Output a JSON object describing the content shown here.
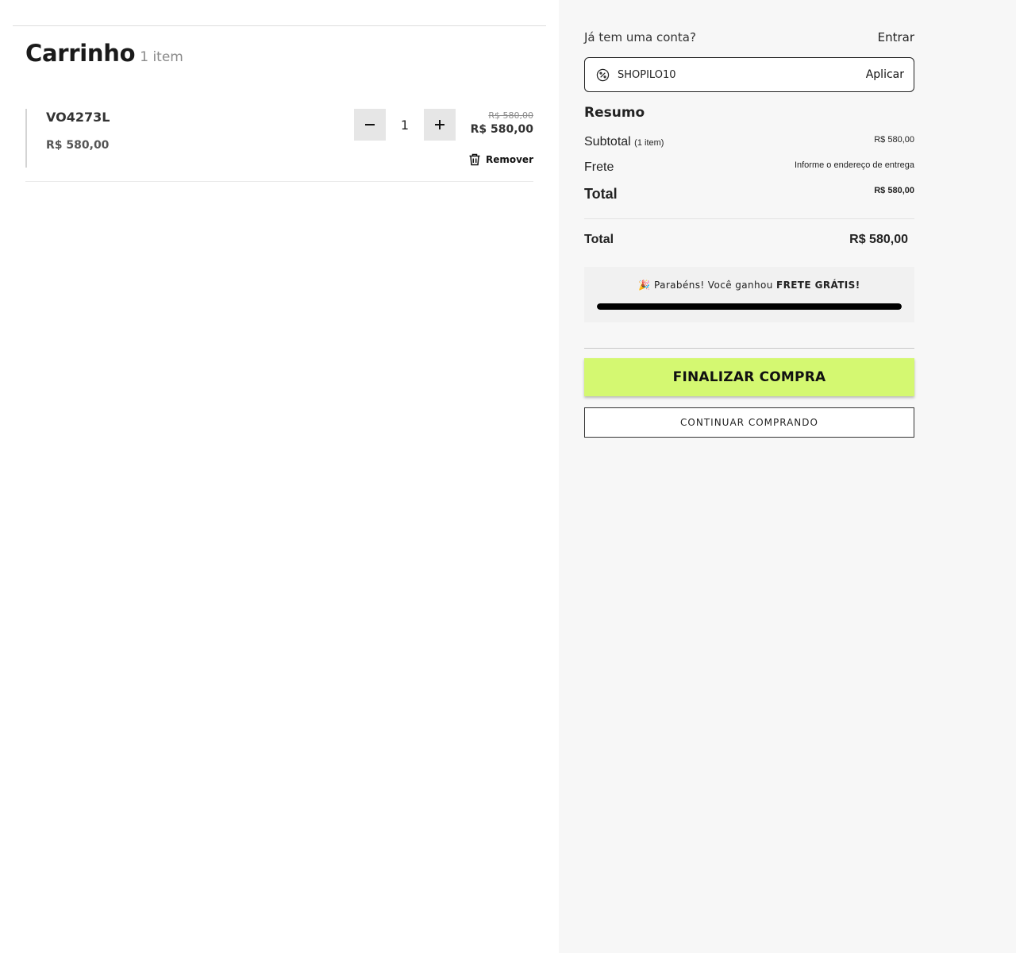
{
  "cart": {
    "title": "Carrinho",
    "count_label": "1 item",
    "items": [
      {
        "name": "VO4273L",
        "unit_price": "R$ 580,00",
        "quantity": "1",
        "old_price": "R$ 580,00",
        "price": "R$ 580,00",
        "remove_label": "Remover"
      }
    ]
  },
  "account": {
    "question": "Já tem uma conta?",
    "login_label": "Entrar"
  },
  "coupon": {
    "value": "SHOPILO10",
    "apply_label": "Aplicar"
  },
  "summary": {
    "title": "Resumo",
    "subtotal_label": "Subtotal",
    "subtotal_count": "(1 item)",
    "subtotal_value": "R$ 580,00",
    "shipping_label": "Frete",
    "shipping_value": "Informe o endereço de entrega",
    "total_label": "Total",
    "total_value": "R$ 580,00"
  },
  "grand_total": {
    "label": "Total",
    "value": "R$ 580,00"
  },
  "free_shipping": {
    "emoji": "🎉",
    "message": "Parabéns! Você ganhou",
    "highlight": "FRETE GRÁTIS!",
    "progress_percent": 100
  },
  "actions": {
    "checkout_label": "FINALIZAR COMPRA",
    "continue_label": "CONTINUAR COMPRANDO"
  },
  "colors": {
    "accent": "#d4f871",
    "panel_bg": "#f7f7f7"
  },
  "icons": {
    "minus": "minus-icon",
    "plus": "plus-icon",
    "trash": "trash-icon",
    "coupon": "discount-percent-icon"
  }
}
